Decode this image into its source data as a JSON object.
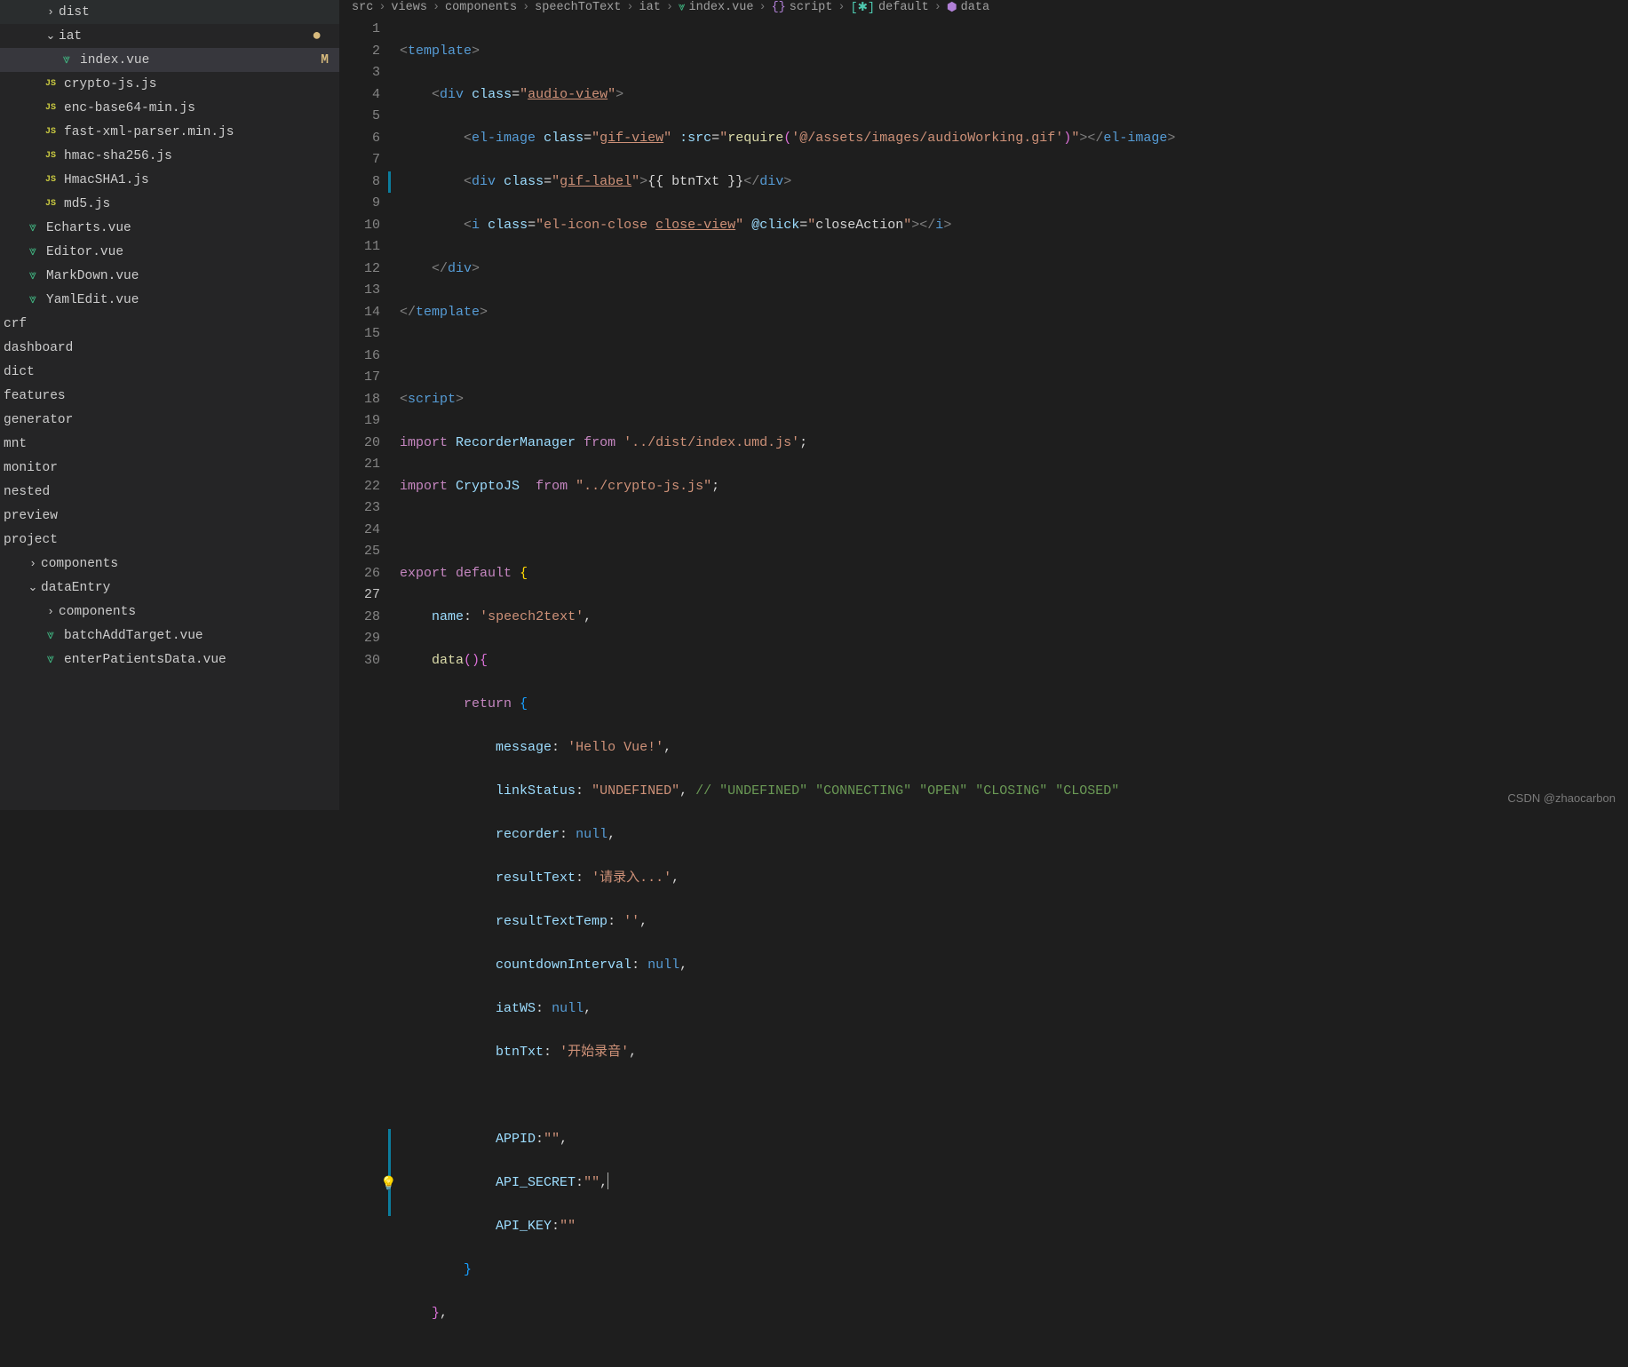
{
  "sidebar": {
    "items": [
      {
        "label": "dist",
        "type": "folder",
        "level": 2,
        "chevron": "right"
      },
      {
        "label": "iat",
        "type": "folder",
        "level": 2,
        "chevron": "down",
        "dot": true
      },
      {
        "label": "index.vue",
        "type": "vue",
        "level": 3,
        "active": true,
        "modified": "M"
      },
      {
        "label": "crypto-js.js",
        "type": "js",
        "level": 2
      },
      {
        "label": "enc-base64-min.js",
        "type": "js",
        "level": 2
      },
      {
        "label": "fast-xml-parser.min.js",
        "type": "js",
        "level": 2
      },
      {
        "label": "hmac-sha256.js",
        "type": "js",
        "level": 2
      },
      {
        "label": "HmacSHA1.js",
        "type": "js",
        "level": 2
      },
      {
        "label": "md5.js",
        "type": "js",
        "level": 2
      },
      {
        "label": "Echarts.vue",
        "type": "vue",
        "level": 1
      },
      {
        "label": "Editor.vue",
        "type": "vue",
        "level": 1
      },
      {
        "label": "MarkDown.vue",
        "type": "vue",
        "level": 1
      },
      {
        "label": "YamlEdit.vue",
        "type": "vue",
        "level": 1
      },
      {
        "label": "crf",
        "type": "folder-plain",
        "level": 0
      },
      {
        "label": "dashboard",
        "type": "folder-plain",
        "level": 0
      },
      {
        "label": "dict",
        "type": "folder-plain",
        "level": 0
      },
      {
        "label": "features",
        "type": "folder-plain",
        "level": 0
      },
      {
        "label": "generator",
        "type": "folder-plain",
        "level": 0
      },
      {
        "label": "mnt",
        "type": "folder-plain",
        "level": 0
      },
      {
        "label": "monitor",
        "type": "folder-plain",
        "level": 0
      },
      {
        "label": "nested",
        "type": "folder-plain",
        "level": 0
      },
      {
        "label": "preview",
        "type": "folder-plain",
        "level": 0
      },
      {
        "label": "project",
        "type": "folder-plain",
        "level": 0
      },
      {
        "label": "components",
        "type": "folder",
        "level": 1,
        "chevron": "right"
      },
      {
        "label": "dataEntry",
        "type": "folder",
        "level": 1,
        "chevron": "down"
      },
      {
        "label": "components",
        "type": "folder",
        "level": 2,
        "chevron": "right"
      },
      {
        "label": "batchAddTarget.vue",
        "type": "vue",
        "level": 2
      },
      {
        "label": "enterPatientsData.vue",
        "type": "vue",
        "level": 2
      }
    ]
  },
  "breadcrumb": {
    "parts": [
      {
        "label": "src"
      },
      {
        "label": "views"
      },
      {
        "label": "components"
      },
      {
        "label": "speechToText"
      },
      {
        "label": "iat"
      },
      {
        "label": "index.vue",
        "icon": "vue"
      },
      {
        "label": "script",
        "icon": "braces"
      },
      {
        "label": "default",
        "icon": "module"
      },
      {
        "label": "data",
        "icon": "cube"
      }
    ]
  },
  "gutter": {
    "lines": [
      "1",
      "2",
      "3",
      "4",
      "5",
      "6",
      "7",
      "8",
      "9",
      "10",
      "11",
      "12",
      "13",
      "14",
      "15",
      "16",
      "17",
      "18",
      "19",
      "20",
      "21",
      "22",
      "23",
      "24",
      "25",
      "26",
      "27",
      "28",
      "29",
      "30"
    ],
    "activeLine": 27
  },
  "code": {
    "l1_tag": "template",
    "l2_tag": "div",
    "l2_class": "audio-view",
    "l3_tag": "el-image",
    "l3_class": "gif-view",
    "l3_src_attr": ":src",
    "l3_src_val": "require('@/assets/images/audioWorking.gif')",
    "l4_tag": "div",
    "l4_class": "gif-label",
    "l4_expr": "{{ btnTxt }}",
    "l5_tag": "i",
    "l5_class": "el-icon-close ",
    "l5_class2": "close-view",
    "l5_click": "@click",
    "l5_click_val": "closeAction",
    "l9_tag": "script",
    "l10_import": "import",
    "l10_name": "RecorderManager",
    "l10_from": "from",
    "l10_path": "'../dist/index.umd.js'",
    "l11_name": "CryptoJS",
    "l11_path": "\"../crypto-js.js\"",
    "l13_export": "export",
    "l13_default": "default",
    "l14_name_key": "name",
    "l14_name_val": "'speech2text'",
    "l15_data": "data",
    "l16_return": "return",
    "l17_key": "message",
    "l17_val": "'Hello Vue!'",
    "l18_key": "linkStatus",
    "l18_val": "\"UNDEFINED\"",
    "l18_comment": "// \"UNDEFINED\" \"CONNECTING\" \"OPEN\" \"CLOSING\" \"CLOSED\"",
    "l19_key": "recorder",
    "l19_val": "null",
    "l20_key": "resultText",
    "l20_val": "'请录入...'",
    "l21_key": "resultTextTemp",
    "l21_val": "''",
    "l22_key": "countdownInterval",
    "l22_val": "null",
    "l23_key": "iatWS",
    "l23_val": "null",
    "l24_key": "btnTxt",
    "l24_val": "'开始录音'",
    "l26_key": "APPID",
    "l26_val": "\"\"",
    "l27_key": "API_SECRET",
    "l27_val": "\"\"",
    "l28_key": "API_KEY",
    "l28_val": "\"\""
  },
  "watermark": "CSDN @zhaocarbon"
}
